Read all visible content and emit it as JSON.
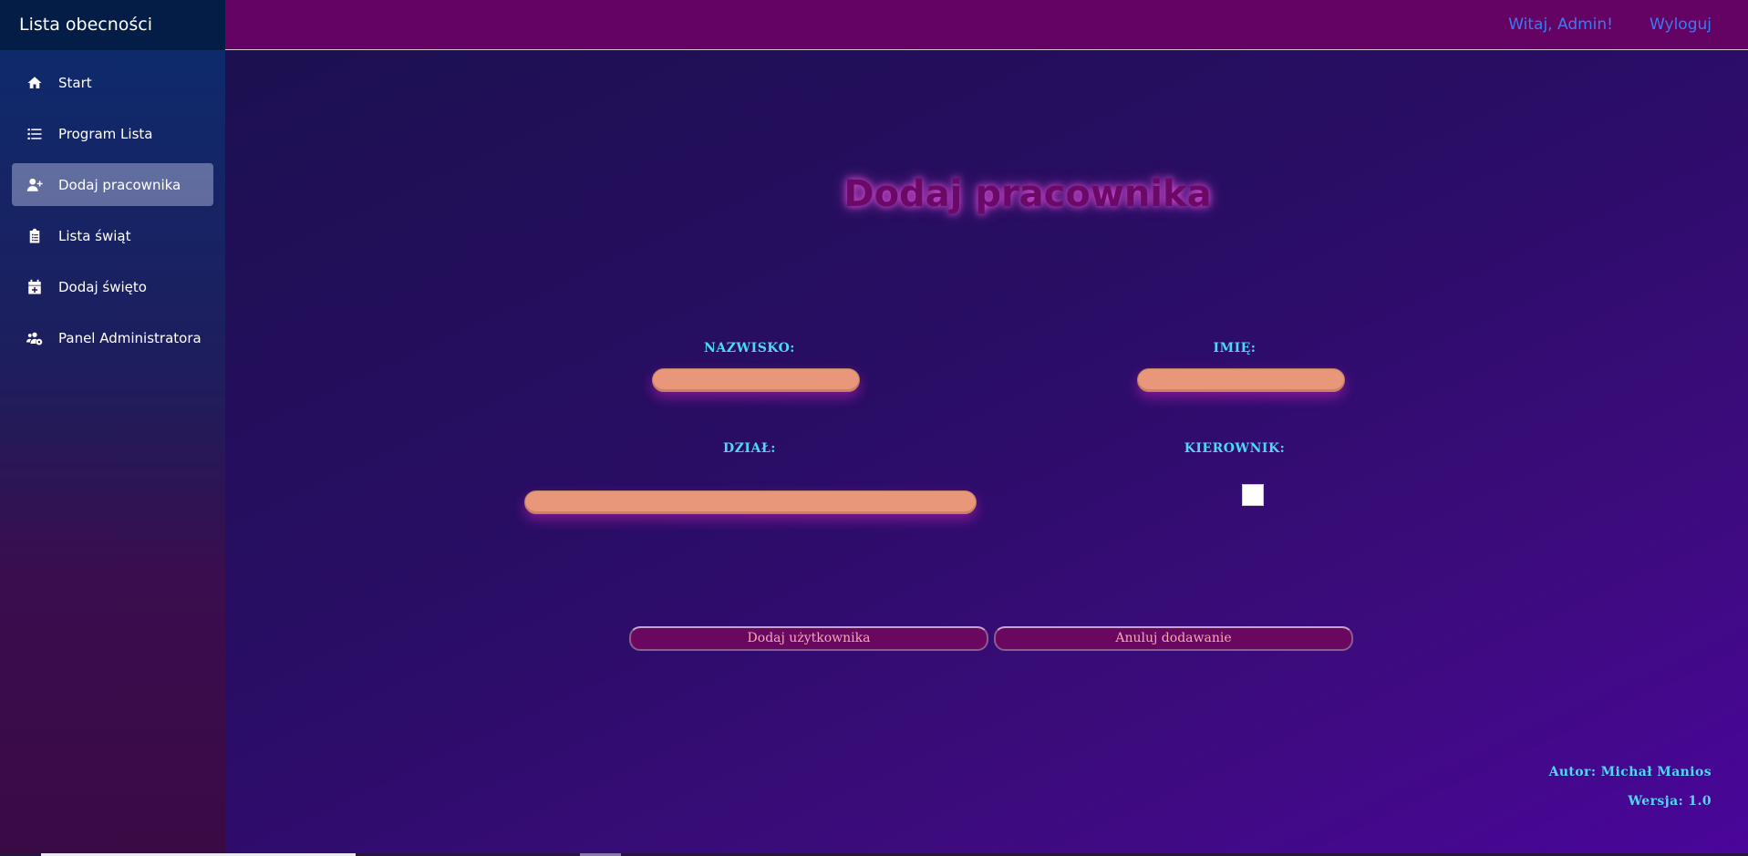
{
  "brand": {
    "title": "Lista obecności"
  },
  "sidebar": {
    "items": [
      {
        "label": "Start",
        "icon": "home-icon",
        "active": false
      },
      {
        "label": "Program Lista",
        "icon": "list-icon",
        "active": false
      },
      {
        "label": "Dodaj pracownika",
        "icon": "user-plus-icon",
        "active": true
      },
      {
        "label": "Lista świąt",
        "icon": "clipboard-list-icon",
        "active": false
      },
      {
        "label": "Dodaj święto",
        "icon": "calendar-plus-icon",
        "active": false
      },
      {
        "label": "Panel Administratora",
        "icon": "users-cog-icon",
        "active": false
      }
    ]
  },
  "topbar": {
    "greeting": "Witaj, Admin!",
    "logout": "Wyloguj"
  },
  "page": {
    "title": "Dodaj pracownika"
  },
  "form": {
    "surname_label": "NAZWISKO:",
    "surname_value": "",
    "name_label": "IMIĘ:",
    "name_value": "",
    "department_label": "DZIAŁ:",
    "department_value": "",
    "manager_label": "KIEROWNIK:",
    "manager_checked": false,
    "submit_label": "Dodaj użytkownika",
    "cancel_label": "Anuluj dodawanie"
  },
  "footer": {
    "author": "Autor: Michał Manios",
    "version": "Wersja: 1.0"
  },
  "colors": {
    "topbar": "#650365",
    "sidebar_header": "#031d46",
    "input_fill": "#e9977a",
    "label_text": "#4fd8f5",
    "link_text": "#3a7bf2",
    "button_fill": "#6a0860"
  }
}
